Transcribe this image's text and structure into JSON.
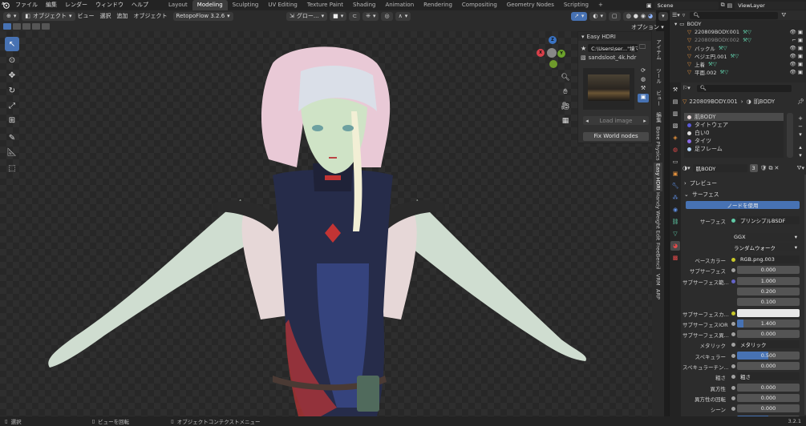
{
  "menu": [
    "ファイル",
    "編集",
    "レンダー",
    "ウィンドウ",
    "ヘルプ"
  ],
  "workspaces": [
    "Layout",
    "Modeling",
    "Sculpting",
    "UV Editing",
    "Texture Paint",
    "Shading",
    "Animation",
    "Rendering",
    "Compositing",
    "Geometry Nodes",
    "Scripting"
  ],
  "active_workspace": "Modeling",
  "scene": "Scene",
  "view_layer": "ViewLayer",
  "viewport_header": {
    "mode": "オブジェクト",
    "menus": [
      "ビュー",
      "選択",
      "追加",
      "オブジェクト"
    ],
    "addon": "RetopoFlow 3.2.6",
    "orientation": "グロー...",
    "options": "オプション"
  },
  "easy_hdri": {
    "title": "Easy HDRI",
    "path": "C:\\Users\\ser...\"境マップ\\",
    "file": "sandsloot_4k.hdr",
    "load_image": "Load image",
    "fix_world": "Fix World nodes"
  },
  "side_tabs": [
    "アイテム",
    "ツール",
    "ビュー",
    "編集",
    "Bone Physics",
    "Easy HDRI",
    "Handy Weight Edit",
    "FreeBencil",
    "VRM",
    "ARP"
  ],
  "outliner": {
    "root": "BODY",
    "items": [
      "220809BODY.001",
      "220809BODY.002",
      "バックル",
      "ベジエ円.001",
      "上着",
      "平面.002"
    ]
  },
  "properties": {
    "object": "220809BODY.001",
    "material": "肌BODY",
    "slots": [
      "肌BODY",
      "タイトウェア",
      "白い0",
      "タイツ",
      "足フレーム"
    ],
    "material_name": "肌BODY",
    "users": "3",
    "preview": "プレビュー",
    "surface_section": "サーフェス",
    "use_nodes": "ノードを使用",
    "surface_label": "サーフェス",
    "surface_value": "プリンシプルBSDF",
    "distribution": "GGX",
    "subsurface_method": "ランダムウォーク",
    "rows": [
      {
        "label": "ベースカラー",
        "value": "RGB.png.003",
        "kind": "dark"
      },
      {
        "label": "サブサーフェス",
        "value": "0.000",
        "kind": "num"
      },
      {
        "label": "サブサーフェス範...",
        "value": "1.000",
        "kind": "num"
      },
      {
        "label": "",
        "value": "0.200",
        "kind": "num"
      },
      {
        "label": "",
        "value": "0.100",
        "kind": "num"
      },
      {
        "label": "サブサーフェスカ...",
        "value": "",
        "kind": "white"
      },
      {
        "label": "サブサーフェスIOR",
        "value": "1.400",
        "kind": "num"
      },
      {
        "label": "サブサーフェス異...",
        "value": "0.000",
        "kind": "num"
      },
      {
        "label": "メタリック",
        "value": "メタリック",
        "kind": "dark"
      },
      {
        "label": "スペキュラー",
        "value": "0.500",
        "kind": "fill"
      },
      {
        "label": "スペキュラーチン...",
        "value": "0.000",
        "kind": "num"
      },
      {
        "label": "粗さ",
        "value": "粗さ",
        "kind": "dark"
      },
      {
        "label": "異方性",
        "value": "0.000",
        "kind": "num"
      },
      {
        "label": "異方性の回転",
        "value": "0.000",
        "kind": "num"
      },
      {
        "label": "シーン",
        "value": "0.000",
        "kind": "num"
      },
      {
        "label": "シーンチント",
        "value": "0.500",
        "kind": "fill"
      }
    ]
  },
  "status": {
    "select": "選択",
    "rotate": "ビューを回転",
    "context": "オブジェクトコンテクストメニュー",
    "version": "3.2.1"
  },
  "colors": {
    "accent": "#4772b3",
    "object_orange": "#e3913d",
    "mesh_green": "#5fc9a6"
  }
}
